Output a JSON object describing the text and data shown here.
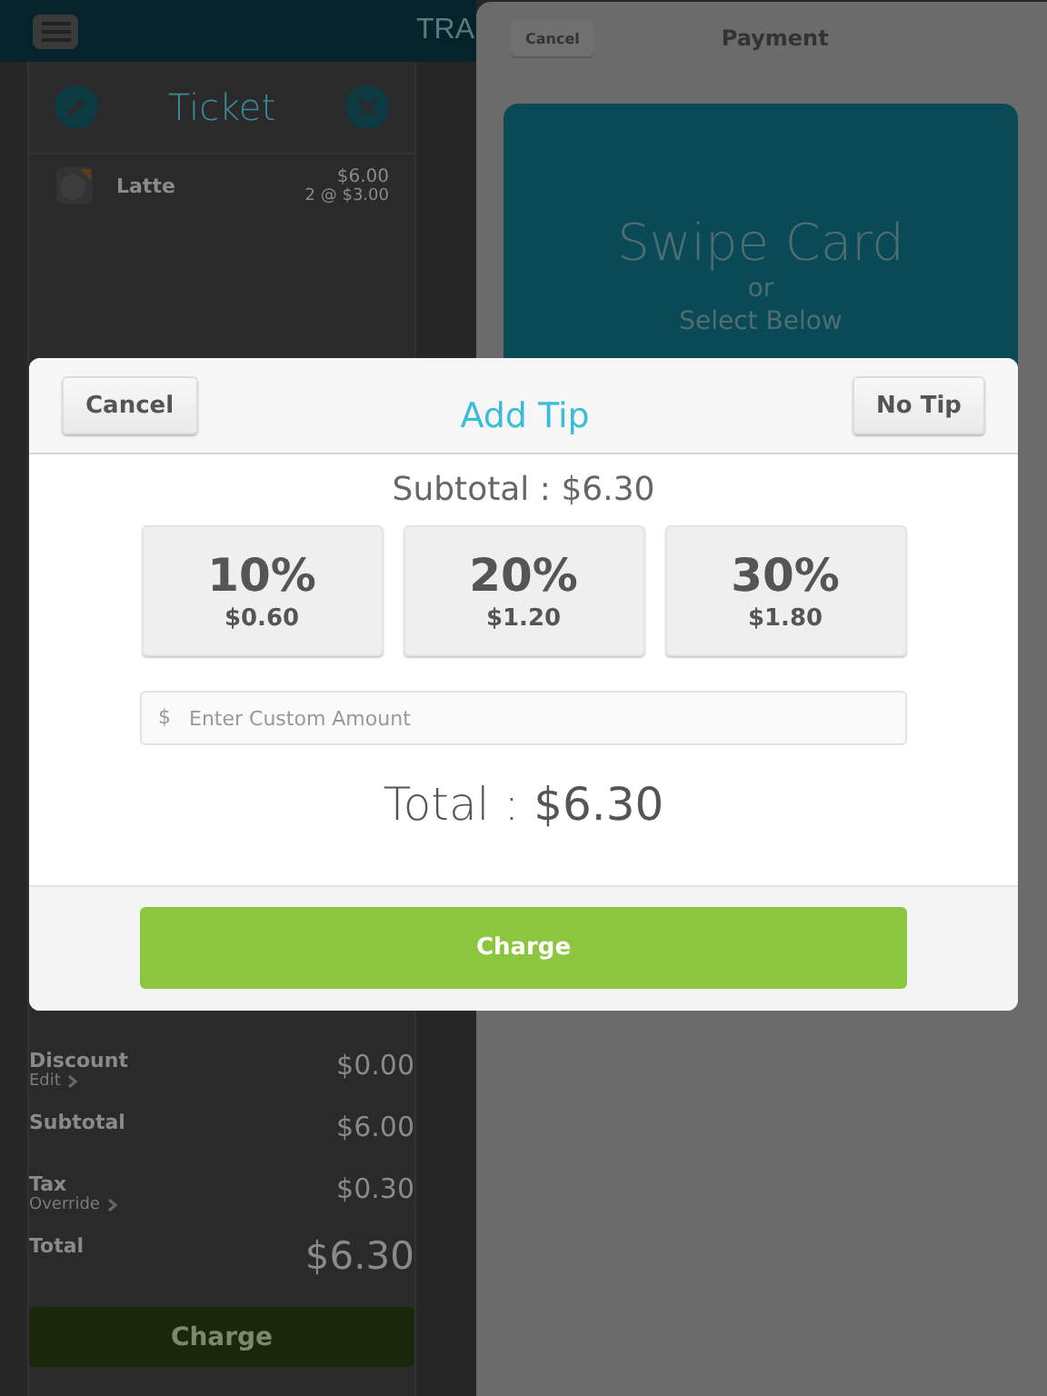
{
  "top_bar": {
    "title": "TRA"
  },
  "ticket": {
    "title": "Ticket",
    "items": [
      {
        "name": "Latte",
        "price": "$6.00",
        "quantity": "2 @ $3.00"
      }
    ],
    "summary": [
      {
        "kind": "line",
        "label": "Discount",
        "link": "Edit",
        "value": "$0.00"
      },
      {
        "kind": "line",
        "label": "Subtotal",
        "value": "$6.00"
      },
      {
        "kind": "line",
        "label": "Tax",
        "link": "Override",
        "value": "$0.30"
      },
      {
        "kind": "total",
        "label": "Total",
        "value": "$6.30"
      }
    ],
    "charge_button": "Charge"
  },
  "payment": {
    "cancel_button": "Cancel",
    "title": "Payment",
    "card_prompt": {
      "title": "Swipe Card",
      "separator": "or",
      "subtitle": "Select Below"
    }
  },
  "tip_dialog": {
    "cancel_button": "Cancel",
    "title": "Add Tip",
    "no_tip_button": "No Tip",
    "subtotal": "Subtotal : $6.30",
    "options": [
      {
        "percent": "10%",
        "amount": "$0.60",
        "selected": false
      },
      {
        "percent": "20%",
        "amount": "$1.20",
        "selected": false
      },
      {
        "percent": "30%",
        "amount": "$1.80",
        "selected": false
      }
    ],
    "custom_amount": {
      "prefix": "$",
      "placeholder": "Enter Custom Amount"
    },
    "total": "Total : **$6.30**",
    "charge_button": "Charge"
  }
}
